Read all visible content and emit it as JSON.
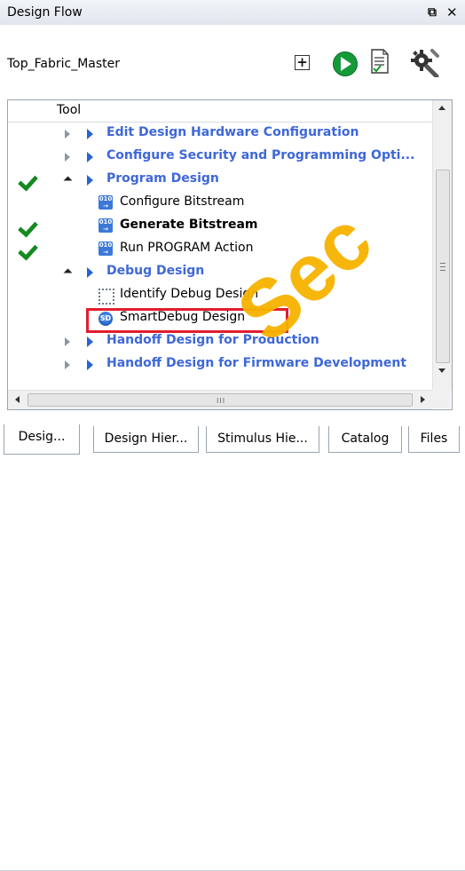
{
  "panel": {
    "title": "Design Flow",
    "float_icon": "⧉",
    "close_icon": "✕"
  },
  "project": {
    "name": "Top_Fabric_Master",
    "toolbar": {
      "expand_icon": "expand-all-icon",
      "run_icon": "run-icon",
      "report_icon": "report-icon",
      "settings_icon": "settings-icon"
    }
  },
  "tree": {
    "column_header": "Tool",
    "rows": [
      {
        "type": "category",
        "label": "Edit Design Hardware Configuration",
        "expanded": false,
        "checked": false
      },
      {
        "type": "category",
        "label": "Configure Security and Programming Opti...",
        "expanded": false,
        "checked": false
      },
      {
        "type": "category",
        "label": "Program Design",
        "expanded": true,
        "checked": true
      },
      {
        "type": "task",
        "label": "Configure Bitstream",
        "icon": "bitstream-icon",
        "bold": false,
        "checked": false
      },
      {
        "type": "task",
        "label": "Generate Bitstream",
        "icon": "bitstream-icon",
        "bold": true,
        "checked": true
      },
      {
        "type": "task",
        "label": "Run PROGRAM Action",
        "icon": "bitstream-icon",
        "bold": false,
        "checked": true
      },
      {
        "type": "category",
        "label": "Debug Design",
        "expanded": true,
        "checked": false
      },
      {
        "type": "task",
        "label": "Identify Debug Design",
        "icon": "identify-debug-icon",
        "bold": false,
        "checked": false
      },
      {
        "type": "task",
        "label": "SmartDebug Design",
        "icon": "smartdebug-icon",
        "bold": false,
        "checked": false,
        "highlighted": true
      },
      {
        "type": "category",
        "label": "Handoff Design for Production",
        "expanded": false,
        "checked": false
      },
      {
        "type": "category",
        "label": "Handoff Design for Firmware Development",
        "expanded": false,
        "checked": false
      }
    ]
  },
  "tabs": [
    {
      "label": "Desig...",
      "active": true
    },
    {
      "label": "Design Hier...",
      "active": false
    },
    {
      "label": "Stimulus Hie...",
      "active": false
    },
    {
      "label": "Catalog",
      "active": false
    },
    {
      "label": "Files",
      "active": false
    }
  ],
  "colors": {
    "category_text": "#3e67d9",
    "check_green": "#158a21",
    "highlight_red": "#e21d2d",
    "watermark_orange": "#f7b300"
  },
  "watermark": {
    "text": "Sec"
  }
}
